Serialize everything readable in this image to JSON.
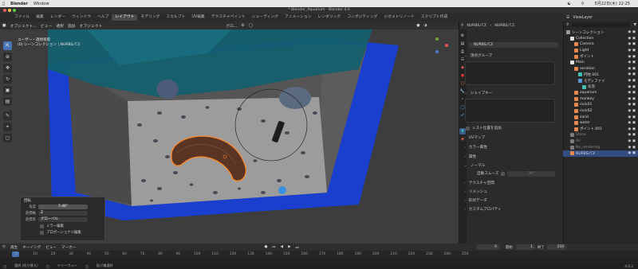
{
  "macbar": {
    "app": "Blender",
    "menus": [
      "Window"
    ],
    "right": {
      "scene_label": "Scene",
      "datetime": "5月22日(木) 22:25"
    }
  },
  "window_title": "* Blender_Aquarium - Blender 4.0",
  "menus": [
    "ファイル",
    "編集",
    "レンダー",
    "ウィンドウ",
    "ヘルプ"
  ],
  "workspaces": [
    "レイアウト",
    "モデリング",
    "スカルプト",
    "UV編集",
    "テクスチャペイント",
    "シェーディング",
    "アニメーション",
    "レンダリング",
    "コンポジティング",
    "ジオメトリノード",
    "スクリプト作成"
  ],
  "active_workspace": "レイアウト",
  "viewport": {
    "header": {
      "mode": "オブジェクト...",
      "menus": [
        "ビュー",
        "選択",
        "追加",
        "オブジェクト"
      ],
      "transform": "グロ...",
      "options_button": "オプション"
    },
    "info_line1": "ユーザー・透視投影",
    "info_line2": "(0) シーンコレクション | NURBSパス",
    "tools": [
      "select-icon",
      "cursor-icon",
      "move-icon",
      "rotate-icon",
      "scale-icon",
      "transform-icon",
      "annotate-icon",
      "measure-icon",
      "add-cube-icon"
    ]
  },
  "operator_panel": {
    "title": "回転",
    "angle_label": "角度",
    "angle_value": "7.46°",
    "axis_label": "座標軸",
    "axis_value": "Z",
    "orient_label": "座標系",
    "orient_value": "グローバル",
    "mirror_edit": "ミラー編集",
    "proportional_edit": "プロポーショナル編集"
  },
  "properties": {
    "breadcrumb_object": "NURBSパス",
    "breadcrumb_data": "NURBSパス",
    "data_name": "NURBSパス",
    "sections": [
      "頂点グループ",
      "シェイプキー",
      "UVマップ",
      "カラー属性",
      "属性",
      "ノーマル",
      "テクスチャ空間",
      "リメッシュ",
      "形状データ",
      "カスタムプロパティ"
    ],
    "rest_position": "レスト位置を追加",
    "autosmooth_label": "自動スムーズ",
    "autosmooth_value": "30°"
  },
  "outliner": {
    "view_layer": "ViewLayer",
    "rows": [
      {
        "label": "シーンコレクション",
        "indent": 0,
        "color": "#9a9a9a"
      },
      {
        "label": "Collection",
        "indent": 1,
        "color": "#e0e0e0"
      },
      {
        "label": "Camera",
        "indent": 2,
        "color": "#e8884e"
      },
      {
        "label": "Light",
        "indent": 2,
        "color": "#e8884e"
      },
      {
        "label": "ポイント",
        "indent": 2,
        "color": "#e8884e"
      },
      {
        "label": "Main",
        "indent": 1,
        "color": "#e0e0e0"
      },
      {
        "label": "aeration",
        "indent": 2,
        "color": "#e8884e"
      },
      {
        "label": "円柱.001",
        "indent": 3,
        "color": "#40c0b0"
      },
      {
        "label": "モディファイ",
        "indent": 3,
        "color": "#5b9bd5"
      },
      {
        "label": "気泡",
        "indent": 4,
        "color": "#40c0b0"
      },
      {
        "label": "aquarium",
        "indent": 2,
        "color": "#e8884e"
      },
      {
        "label": "monkey",
        "indent": 2,
        "color": "#e8884e"
      },
      {
        "label": "rock01",
        "indent": 2,
        "color": "#e8884e"
      },
      {
        "label": "rock02",
        "indent": 2,
        "color": "#e8884e"
      },
      {
        "label": "sand",
        "indent": 2,
        "color": "#e8884e"
      },
      {
        "label": "water",
        "indent": 2,
        "color": "#e8884e"
      },
      {
        "label": "ポイント.001",
        "indent": 2,
        "color": "#e8884e"
      },
      {
        "label": "Stone",
        "indent": 1,
        "color": "#7a7a7a"
      },
      {
        "label": "Air",
        "indent": 1,
        "color": "#7a7a7a"
      },
      {
        "label": "No_rendering",
        "indent": 1,
        "color": "#7a7a7a"
      },
      {
        "label": "NURBSパス",
        "indent": 1,
        "color": "#e8884e",
        "selected": true
      }
    ]
  },
  "timeline": {
    "menus": [
      "再生",
      "キーイング",
      "ビュー",
      "マーカー"
    ],
    "current_frame": "0",
    "start_label": "開始",
    "start_value": "1",
    "end_label": "終了",
    "end_value": "250",
    "ticks": [
      "0",
      "10",
      "20",
      "30",
      "40",
      "50",
      "60",
      "70",
      "80",
      "90",
      "100",
      "110",
      "120",
      "130",
      "140",
      "150",
      "160",
      "170",
      "180",
      "190",
      "200",
      "210",
      "220",
      "230",
      "240",
      "250"
    ]
  },
  "status": {
    "items": [
      "選択 (切り替え)",
      "ドリーヴュー",
      "投げ縄選択"
    ],
    "version": "4.0.2"
  }
}
